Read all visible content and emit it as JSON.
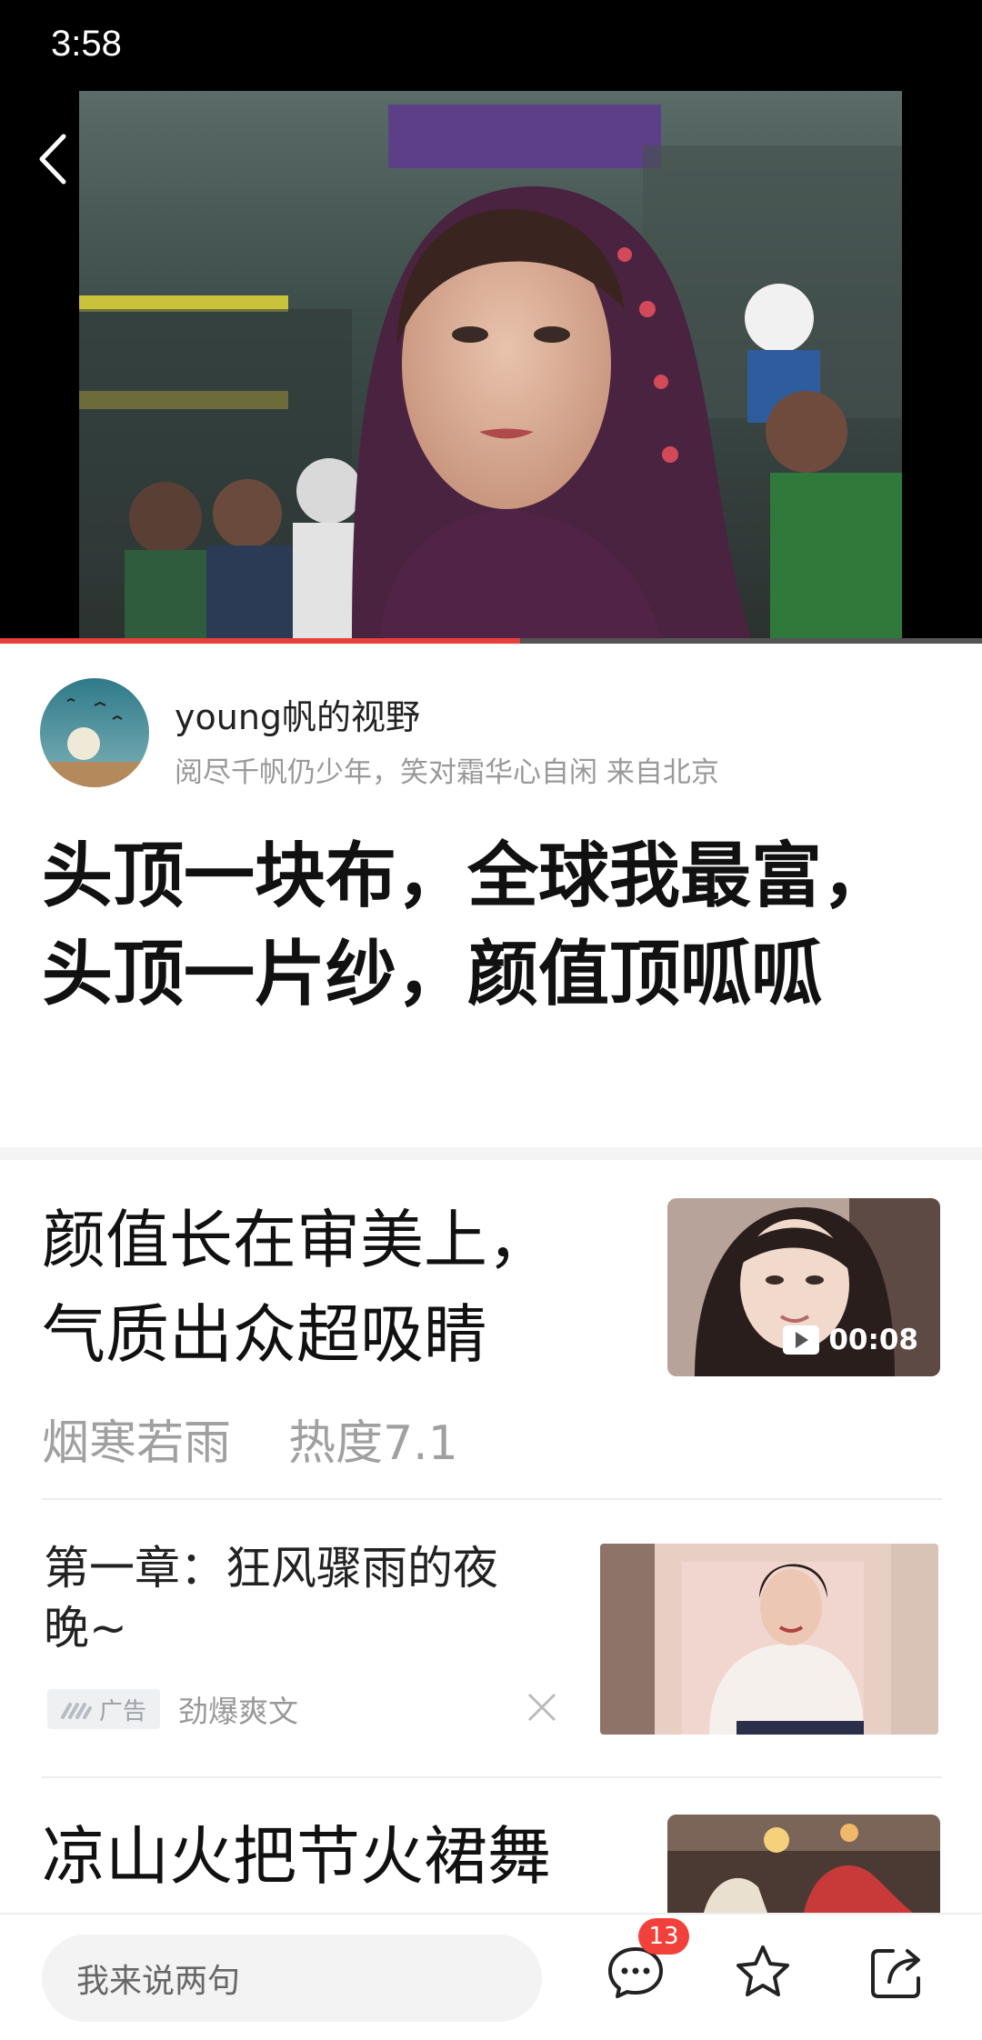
{
  "status_bar": {
    "time": "3:58"
  },
  "video": {
    "progress": 0.53
  },
  "author": {
    "name": "young帆的视野",
    "bio": "阅尽千帆仍少年，笑对霜华心自闲 来自北京"
  },
  "post": {
    "title": "头顶一块布，全球我最富，头顶一片纱，颜值顶呱呱"
  },
  "feed": {
    "item1": {
      "title_line1": "颜值长在审美上，",
      "title_line2": "气质出众超吸睛",
      "author": "烟寒若雨",
      "heat": "热度7.1",
      "duration": "00:08"
    },
    "item2": {
      "title_line1": "第一章：狂风骤雨的夜",
      "title_line2": "晚~",
      "ad_label": "广告",
      "source": "劲爆爽文"
    },
    "item3": {
      "title": "凉山火把节火裙舞"
    }
  },
  "bottom_bar": {
    "comment_placeholder": "我来说两句",
    "comment_count": "13"
  },
  "colors": {
    "accent_red": "#e8403a",
    "badge_red": "#f2413b"
  }
}
